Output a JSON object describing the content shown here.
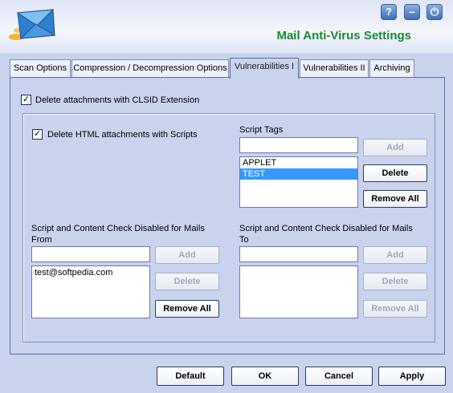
{
  "header": {
    "title": "Mail Anti-Virus Settings",
    "help_label": "?",
    "minimize_label": "–",
    "power_label": "⏻"
  },
  "tabs": [
    {
      "label": "Scan Options",
      "active": false
    },
    {
      "label": "Compression / Decompression Options",
      "active": false
    },
    {
      "label": "Vulnerabilities I",
      "active": true
    },
    {
      "label": "Vulnerabilities II",
      "active": false
    },
    {
      "label": "Archiving",
      "active": false
    }
  ],
  "options": {
    "clsid_label": "Delete attachments with CLSID Extension",
    "clsid_checked": true,
    "html_scripts_label": "Delete HTML attachments with Scripts",
    "html_scripts_checked": true
  },
  "script_tags": {
    "label": "Script Tags",
    "input_value": "",
    "items": [
      {
        "text": "APPLET",
        "selected": false
      },
      {
        "text": "TEST",
        "selected": true
      }
    ],
    "add_label": "Add",
    "delete_label": "Delete",
    "remove_all_label": "Remove All"
  },
  "from_group": {
    "label_line1": "Script and Content Check Disabled for Mails",
    "label_line2": "From",
    "input_value": "",
    "items": [
      {
        "text": "test@softpedia.com",
        "selected": false
      }
    ],
    "add_label": "Add",
    "delete_label": "Delete",
    "remove_all_label": "Remove All"
  },
  "to_group": {
    "label_line1": "Script and Content Check Disabled for Mails",
    "label_line2": "To",
    "input_value": "",
    "items": [],
    "add_label": "Add",
    "delete_label": "Delete",
    "remove_all_label": "Remove All"
  },
  "footer": {
    "default_label": "Default",
    "ok_label": "OK",
    "cancel_label": "Cancel",
    "apply_label": "Apply"
  }
}
